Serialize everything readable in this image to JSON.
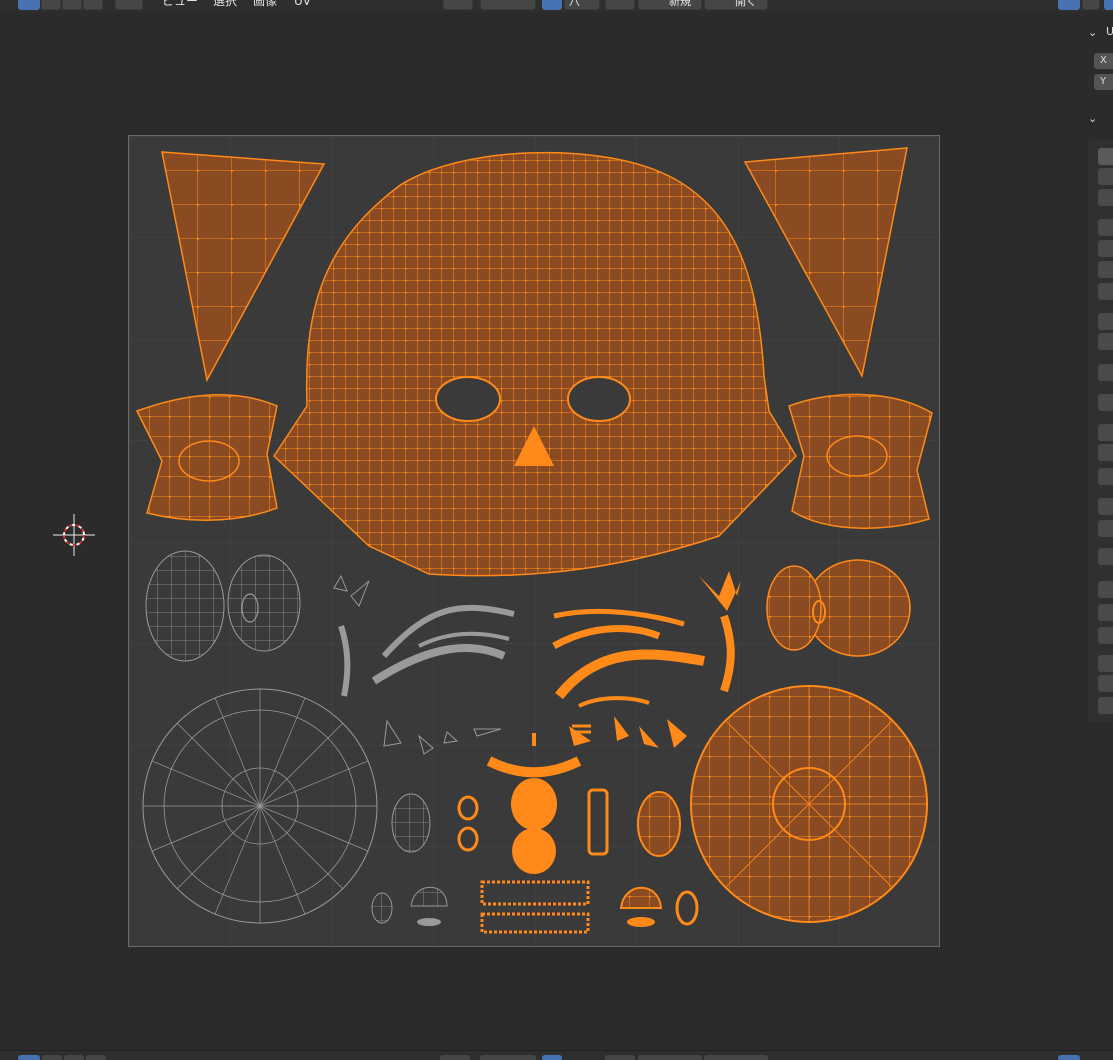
{
  "header": {
    "menus": [
      "ビュー",
      "選択",
      "画像",
      "UV"
    ],
    "new_label": "新規",
    "open_label": "開く",
    "pivot_symbol": "八"
  },
  "sidebar": {
    "section1_title": "U",
    "field_x": "X",
    "field_y": "Y"
  },
  "colors": {
    "background": "#2b2b2b",
    "uv_area": "#3a3a3a",
    "selected_face": "#8a4a22",
    "selected_edge": "#ff8a1a",
    "unselected_edge": "#9a9a9a",
    "accent": "#4772b3"
  },
  "icons": [
    "select-mode-icon",
    "vertex-select-icon",
    "edge-select-icon",
    "face-select-icon",
    "island-select-icon",
    "snap-icon",
    "proportional-edit-icon",
    "pivot-icon",
    "uv-sync-icon",
    "cursor-3d-icon",
    "new-image-icon",
    "open-image-icon",
    "pin-icon",
    "overlay-icon"
  ]
}
